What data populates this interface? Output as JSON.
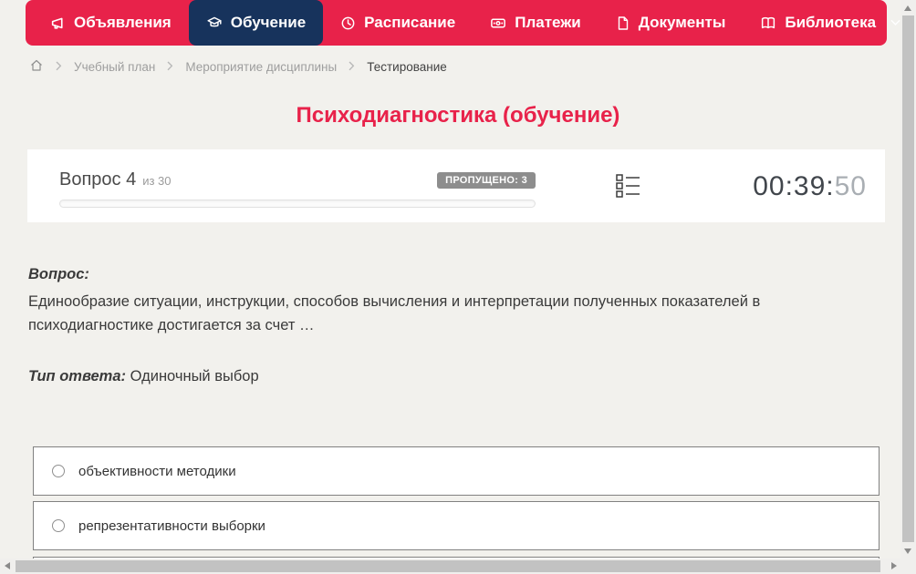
{
  "theme": {
    "accent_red": "#e8224a",
    "active_tab_navy": "#17335c",
    "page_background": "#f2f1ed",
    "badge_gray": "#8d8d8d"
  },
  "nav": {
    "items": [
      {
        "label": "Объявления",
        "icon": "megaphone-icon",
        "active": false
      },
      {
        "label": "Обучение",
        "icon": "graduation-cap-icon",
        "active": true
      },
      {
        "label": "Расписание",
        "icon": "clock-icon",
        "active": false
      },
      {
        "label": "Платежи",
        "icon": "banknote-icon",
        "active": false
      },
      {
        "label": "Документы",
        "icon": "document-icon",
        "active": false
      },
      {
        "label": "Библиотека",
        "icon": "open-book-icon",
        "active": false,
        "has_dropdown": true
      }
    ]
  },
  "breadcrumb": {
    "home_icon": "home-icon",
    "items": [
      "Учебный план",
      "Мероприятие дисциплины",
      "Тестирование"
    ]
  },
  "page": {
    "title": "Психодиагностика (обучение)"
  },
  "quiz_header": {
    "question_label": "Вопрос 4",
    "question_total": "из 30",
    "skipped_badge": "ПРОПУЩЕНО: 3",
    "timer_main": "00:39:",
    "timer_seconds": "50",
    "navigator_icon": "question-list-icon"
  },
  "question": {
    "heading": "Вопрос:",
    "text": "Единообразие ситуации, инструкции, способов вычисления и интерпретации полученных показателей в психодиагностике достигается за счет …",
    "answer_type_label": "Тип ответа:",
    "answer_type_value": "Одиночный выбор"
  },
  "options": [
    {
      "label": "объективности методики",
      "selected": false
    },
    {
      "label": "репрезентативности выборки",
      "selected": false
    }
  ]
}
